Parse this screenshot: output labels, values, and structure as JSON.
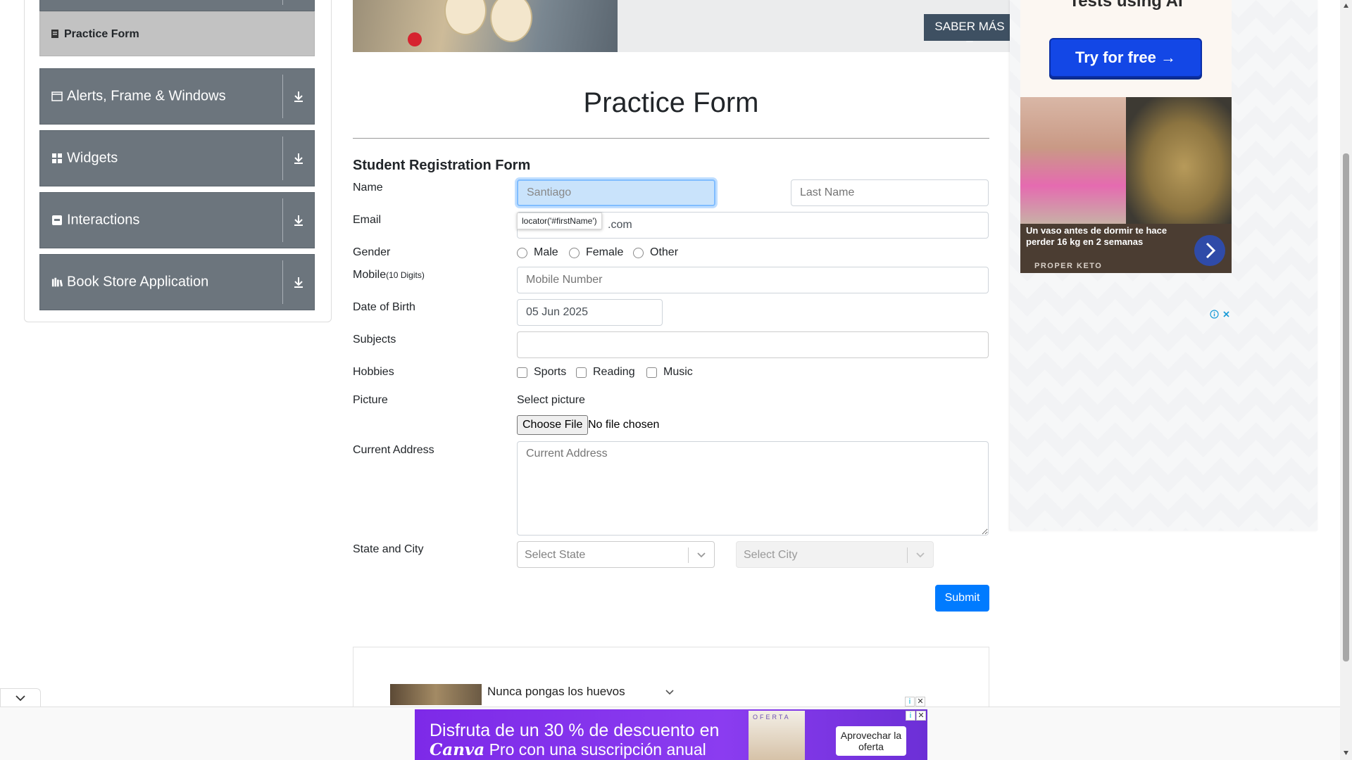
{
  "sidebar": {
    "active_item": "Practice Form",
    "groups": [
      {
        "label": "Alerts, Frame & Windows",
        "icon": "window-icon"
      },
      {
        "label": "Widgets",
        "icon": "widgets-icon"
      },
      {
        "label": "Interactions",
        "icon": "interactions-icon"
      },
      {
        "label": "Book Store Application",
        "icon": "bookstore-icon"
      }
    ]
  },
  "banner": {
    "button_label": "SABER MÁS –"
  },
  "form": {
    "title": "Practice Form",
    "subtitle": "Student Registration Form",
    "labels": {
      "name": "Name",
      "email": "Email",
      "gender": "Gender",
      "mobile": "Mobile",
      "mobile_hint": "(10 Digits)",
      "dob": "Date of Birth",
      "subjects": "Subjects",
      "hobbies": "Hobbies",
      "picture": "Picture",
      "address": "Current Address",
      "state_city": "State and City"
    },
    "first_name_placeholder": "Santiago",
    "last_name_placeholder": "Last Name",
    "email_visible_suffix": ".com",
    "tooltip": "locator('#firstName')",
    "gender_options": [
      "Male",
      "Female",
      "Other"
    ],
    "mobile_placeholder": "Mobile Number",
    "dob_value": "05 Jun 2025",
    "subjects_value": "",
    "hobbies": [
      "Sports",
      "Reading",
      "Music"
    ],
    "picture_label": "Select picture",
    "choose_file": "Choose File",
    "no_file": "No file chosen",
    "address_placeholder": "Current Address",
    "state_placeholder": "Select State",
    "city_placeholder": "Select City",
    "submit": "Submit"
  },
  "bottom_card": {
    "video_title": "Nunca pongas los huevos"
  },
  "right_ad": {
    "headline": "Tests using AI",
    "cta": "Try for free →",
    "caption": "Un vaso antes de dormir te hace perder 16 kg en 2 semanas",
    "brand": "PROPER KETO"
  },
  "bottom_ad": {
    "line1": "Disfruta de un 30 % de descuento en",
    "brand": "Canva",
    "line2": " Pro con una suscripción anual",
    "offer": "OFERTA",
    "cta": "Aprovechar la oferta"
  },
  "colors": {
    "sidebar_group": "#6c757d",
    "active_item": "#c2c2c2",
    "submit": "#007bff",
    "banner_button": "#3e5062",
    "ad_cta": "#1347e6",
    "canva_purple": "#7d2ae8"
  }
}
